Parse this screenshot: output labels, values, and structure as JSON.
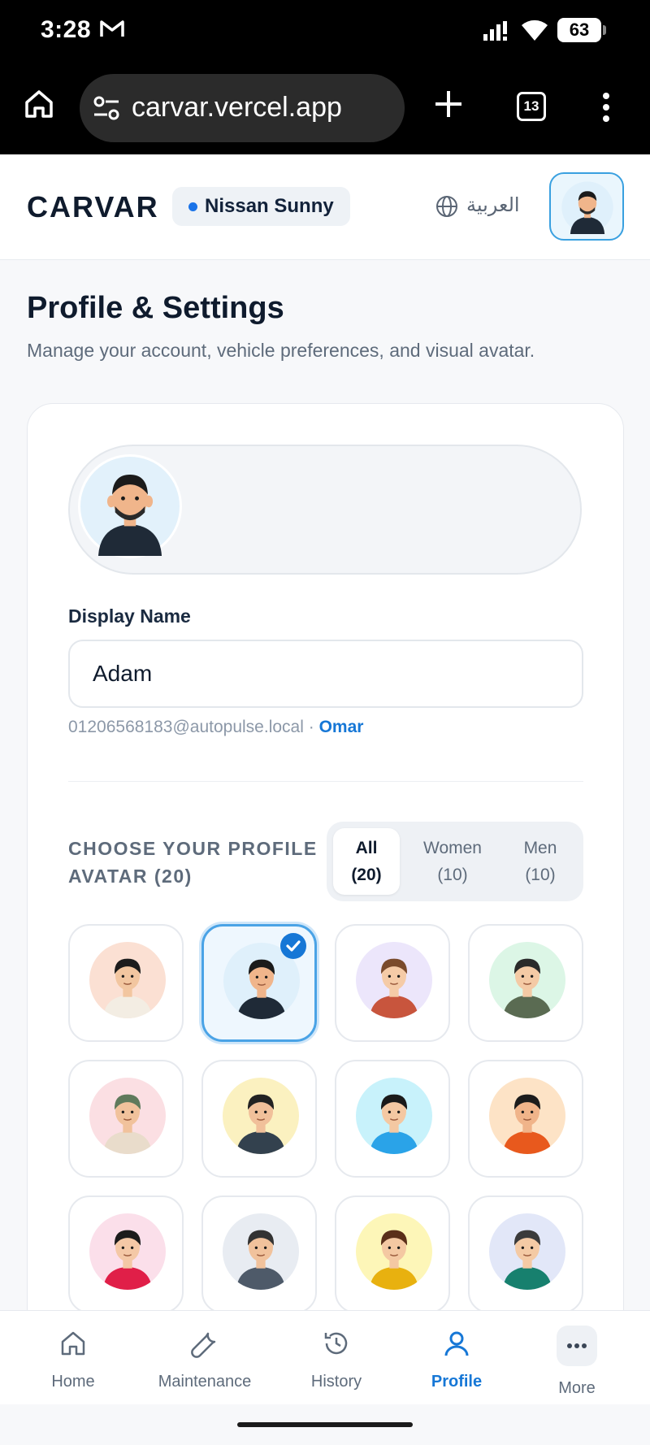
{
  "status_bar": {
    "time": "3:28",
    "battery": "63"
  },
  "browser": {
    "url": "carvar.vercel.app",
    "tab_count": "13"
  },
  "header": {
    "brand": "CARVAR",
    "vehicle": "Nissan Sunny",
    "language": "العربية"
  },
  "page": {
    "title": "Profile & Settings",
    "subtitle": "Manage your account, vehicle preferences, and visual avatar."
  },
  "profile": {
    "display_name_label": "Display Name",
    "display_name_value": "Adam",
    "email": "01206568183@autopulse.local",
    "separator": "·",
    "linked_name": "Omar"
  },
  "avatars": {
    "heading": "CHOOSE YOUR PROFILE AVATAR (20)",
    "filters": [
      {
        "label": "All",
        "count": "(20)",
        "active": true
      },
      {
        "label": "Women",
        "count": "(10)",
        "active": false
      },
      {
        "label": "Men",
        "count": "(10)",
        "active": false
      }
    ],
    "selected_index": 1,
    "tiles": [
      {
        "name": "avatar-woman-dark-hair",
        "bg": "#fbe0d3",
        "skin": "#f2c6a0",
        "hair": "#1c1c1c",
        "shirt": "#f3ede3"
      },
      {
        "name": "avatar-man-beard-selected",
        "bg": "#dff0fb",
        "skin": "#f0b58b",
        "hair": "#1b1b1b",
        "shirt": "#1f2a37"
      },
      {
        "name": "avatar-woman-brown-hair",
        "bg": "#ece6fb",
        "skin": "#f5cba7",
        "hair": "#7a4b2c",
        "shirt": "#c8553d"
      },
      {
        "name": "avatar-man-glasses-green",
        "bg": "#dcf6e6",
        "skin": "#f4caa5",
        "hair": "#2a2a2a",
        "shirt": "#5a6b52"
      },
      {
        "name": "avatar-woman-hijab",
        "bg": "#fbdfe3",
        "skin": "#f1c29c",
        "hair": "#5f7a5c",
        "shirt": "#e9dccb"
      },
      {
        "name": "avatar-man-dark-shirt",
        "bg": "#fbf1c0",
        "skin": "#f1c09a",
        "hair": "#222222",
        "shirt": "#33414e"
      },
      {
        "name": "avatar-woman-ponytail",
        "bg": "#c8f2fb",
        "skin": "#f4c8a2",
        "hair": "#1a1a1a",
        "shirt": "#2aa3e8"
      },
      {
        "name": "avatar-man-curly-hair",
        "bg": "#fde3c6",
        "skin": "#f0b48a",
        "hair": "#1c1c1c",
        "shirt": "#e8591d"
      },
      {
        "name": "avatar-woman-long-black-hair",
        "bg": "#fbdfea",
        "skin": "#f4c8a6",
        "hair": "#1c1c1c",
        "shirt": "#e01f48"
      },
      {
        "name": "avatar-man-gray-shirt",
        "bg": "#e8ecf2",
        "skin": "#f1c29c",
        "hair": "#333333",
        "shirt": "#4e5a69"
      },
      {
        "name": "avatar-woman-curly-hair",
        "bg": "#fdf6b8",
        "skin": "#f4c8a2",
        "hair": "#5a2f1a",
        "shirt": "#e8b10f"
      },
      {
        "name": "avatar-man-glasses-teal",
        "bg": "#e2e7f8",
        "skin": "#f4caa5",
        "hair": "#3b3b3b",
        "shirt": "#17806e"
      }
    ]
  },
  "bottom_nav": [
    {
      "label": "Home",
      "icon": "home-icon",
      "active": false
    },
    {
      "label": "Maintenance",
      "icon": "wrench-icon",
      "active": false
    },
    {
      "label": "History",
      "icon": "history-icon",
      "active": false
    },
    {
      "label": "Profile",
      "icon": "user-icon",
      "active": true
    },
    {
      "label": "More",
      "icon": "more-icon",
      "active": false
    }
  ],
  "colors": {
    "accent": "#1677d6",
    "selected_border": "#4aa3e6"
  }
}
